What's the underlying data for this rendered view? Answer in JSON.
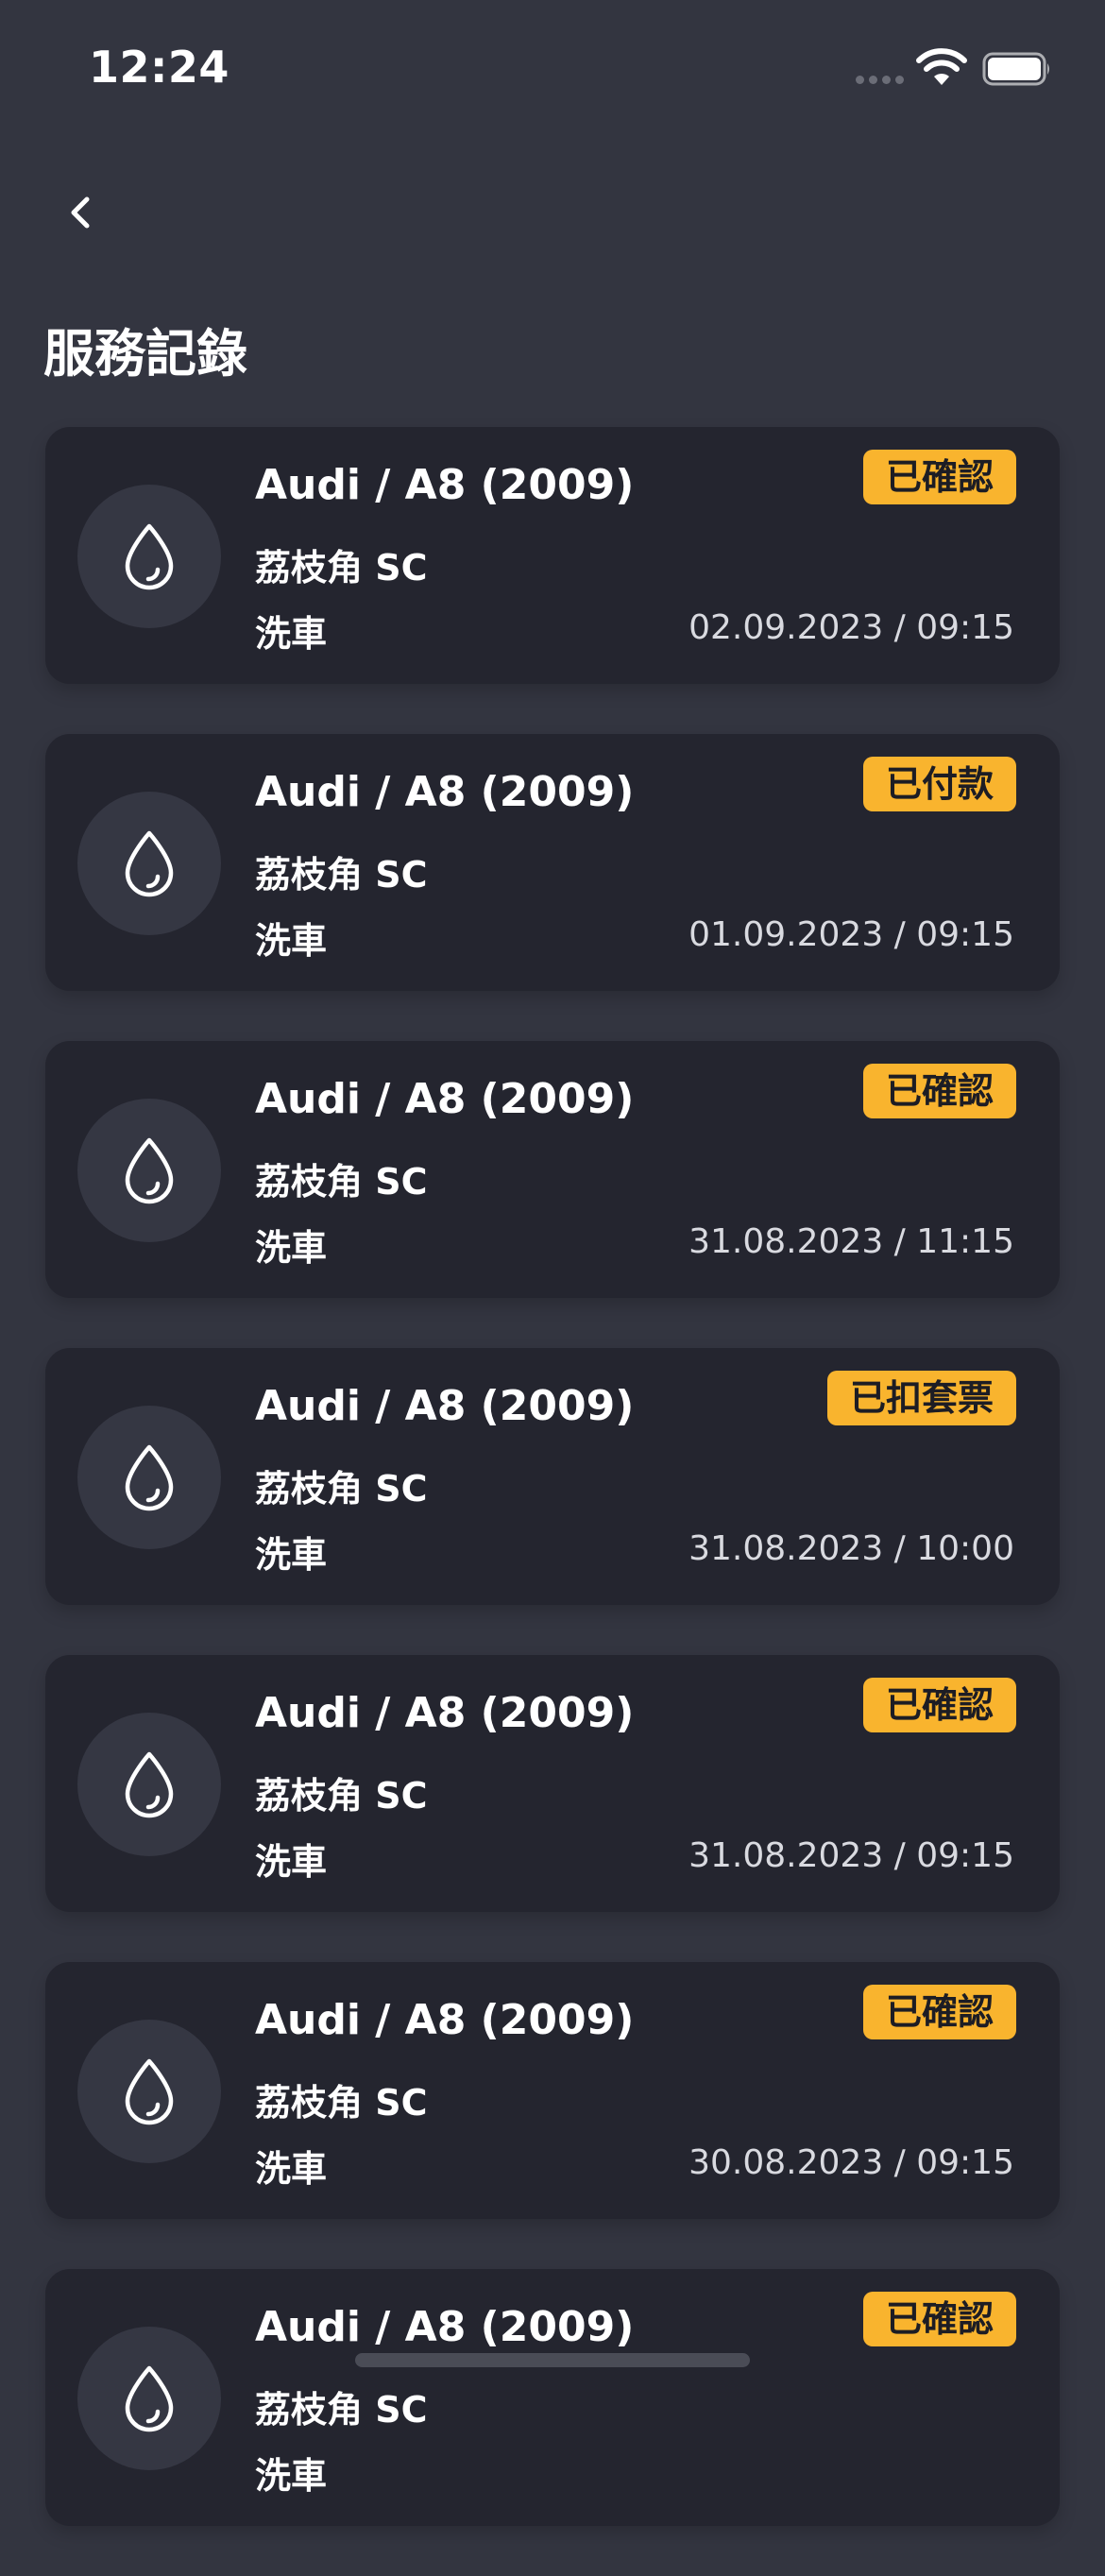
{
  "status_bar": {
    "time": "12:24"
  },
  "header": {
    "title": "服務記錄"
  },
  "colors": {
    "background": "#333540",
    "card": "#24252f",
    "badge": "#f9b42e"
  },
  "records": [
    {
      "vehicle": "Audi / A8 (2009)",
      "location": "荔枝角 SC",
      "service": "洗車",
      "datetime": "02.09.2023 / 09:15",
      "status": "已確認",
      "icon": "water-drop-icon"
    },
    {
      "vehicle": "Audi / A8 (2009)",
      "location": "荔枝角 SC",
      "service": "洗車",
      "datetime": "01.09.2023 / 09:15",
      "status": "已付款",
      "icon": "water-drop-icon"
    },
    {
      "vehicle": "Audi / A8 (2009)",
      "location": "荔枝角 SC",
      "service": "洗車",
      "datetime": "31.08.2023 / 11:15",
      "status": "已確認",
      "icon": "water-drop-icon"
    },
    {
      "vehicle": "Audi / A8 (2009)",
      "location": "荔枝角 SC",
      "service": "洗車",
      "datetime": "31.08.2023 / 10:00",
      "status": "已扣套票",
      "icon": "water-drop-icon"
    },
    {
      "vehicle": "Audi / A8 (2009)",
      "location": "荔枝角 SC",
      "service": "洗車",
      "datetime": "31.08.2023 / 09:15",
      "status": "已確認",
      "icon": "water-drop-icon"
    },
    {
      "vehicle": "Audi / A8 (2009)",
      "location": "荔枝角 SC",
      "service": "洗車",
      "datetime": "30.08.2023 / 09:15",
      "status": "已確認",
      "icon": "water-drop-icon"
    },
    {
      "vehicle": "Audi / A8 (2009)",
      "location": "荔枝角 SC",
      "service": "洗車",
      "datetime": "",
      "status": "已確認",
      "icon": "water-drop-icon"
    }
  ]
}
